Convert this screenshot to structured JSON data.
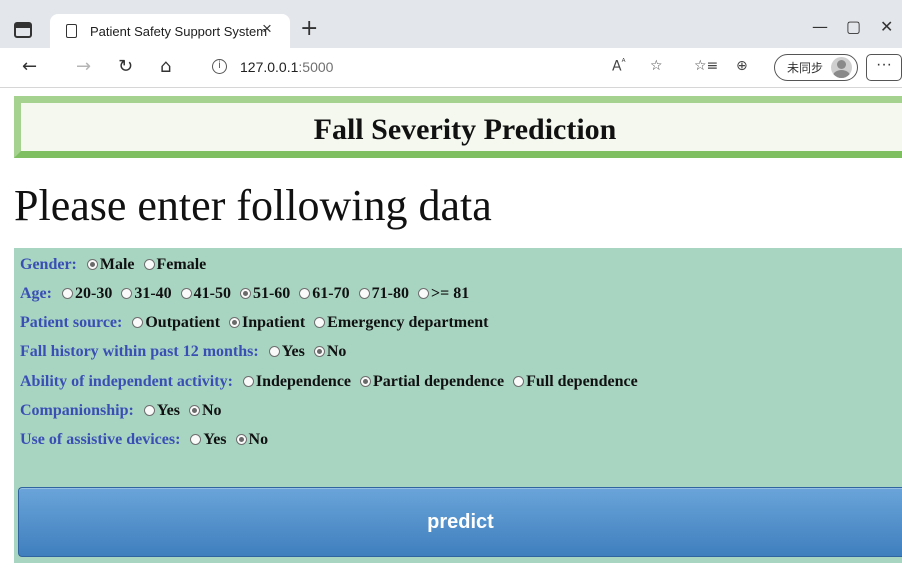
{
  "browser": {
    "tab_title": "Patient Safety Support System",
    "tab_close": "×",
    "new_tab": "+",
    "url_host": "127.0.0.1",
    "url_port": ":5000",
    "profile_label": "未同步",
    "more": "···",
    "window_controls": {
      "minimize": "—",
      "maximize": "▢",
      "close": "✕"
    }
  },
  "page": {
    "title": "Fall Severity Prediction",
    "subtitle": "Please enter following data",
    "submit_label": "predict"
  },
  "form": {
    "gender": {
      "label": "Gender:",
      "options": [
        "Male",
        "Female"
      ],
      "selected": "Male"
    },
    "age": {
      "label": "Age:",
      "options": [
        "20-30",
        "31-40",
        "41-50",
        "51-60",
        "61-70",
        "71-80",
        ">= 81"
      ],
      "selected": "51-60"
    },
    "patient_source": {
      "label": "Patient source:",
      "options": [
        "Outpatient",
        "Inpatient",
        "Emergency department"
      ],
      "selected": "Inpatient"
    },
    "fall_history": {
      "label": "Fall history within past 12 months:",
      "options": [
        "Yes",
        "No"
      ],
      "selected": "No"
    },
    "independent_activity": {
      "label": "Ability of independent activity:",
      "options": [
        "Independence",
        "Partial dependence",
        "Full dependence"
      ],
      "selected": "Partial dependence"
    },
    "companionship": {
      "label": "Companionship:",
      "options": [
        "Yes",
        "No"
      ],
      "selected": "No"
    },
    "assistive_devices": {
      "label": "Use of assistive devices:",
      "options": [
        "Yes",
        "No"
      ],
      "selected": "No"
    }
  },
  "colors": {
    "header_border": "#7fbf62",
    "form_background": "#a8d5c2",
    "question_label": "#3a4fb4",
    "button": "#4a88c7"
  }
}
